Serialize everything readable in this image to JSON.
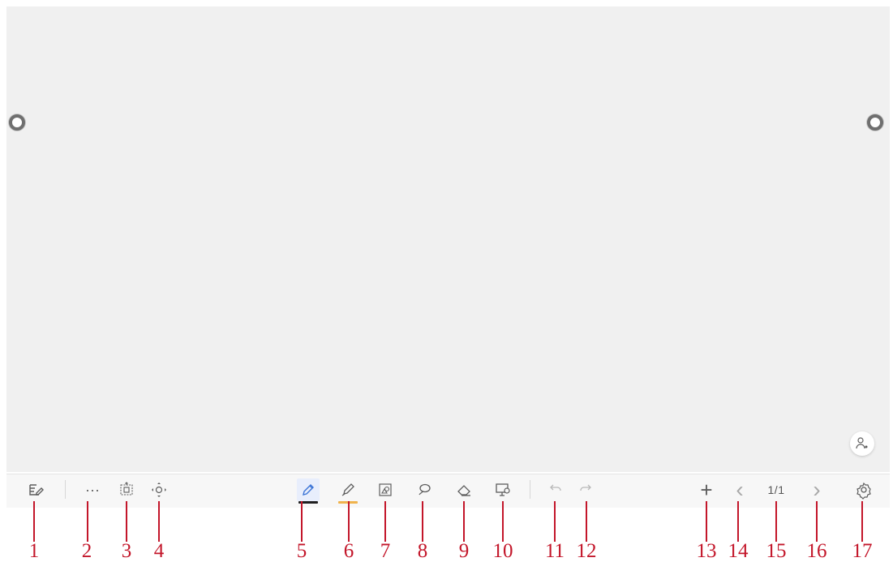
{
  "colors": {
    "canvas_background": "#f0f0f0",
    "toolbar_background": "#f7f7f7",
    "icon": "#5d5d5d",
    "callout_red": "#c3162a",
    "pen_underline": "#1f1f1f",
    "highlighter_underline": "#f0b34c",
    "active_tool_background": "#e8eefc"
  },
  "toolbar": {
    "items": [
      {
        "name": "exit-edit-button",
        "icon": "edit-note-icon"
      },
      {
        "name": "more-button",
        "icon": "ellipsis-icon",
        "label": "···"
      },
      {
        "name": "select-button",
        "icon": "selection-icon"
      },
      {
        "name": "roam-button",
        "icon": "move-icon"
      },
      {
        "name": "pen-button",
        "icon": "pen-icon",
        "active": true
      },
      {
        "name": "highlighter-button",
        "icon": "highlighter-icon"
      },
      {
        "name": "shape-button",
        "icon": "shape-icon"
      },
      {
        "name": "lasso-button",
        "icon": "lasso-icon"
      },
      {
        "name": "eraser-button",
        "icon": "eraser-icon"
      },
      {
        "name": "annotation-button",
        "icon": "presentation-icon"
      },
      {
        "name": "undo-button",
        "icon": "undo-icon"
      },
      {
        "name": "redo-button",
        "icon": "redo-icon"
      },
      {
        "name": "add-page-button",
        "icon": "plus-icon",
        "label": "+"
      },
      {
        "name": "previous-page-button",
        "icon": "chevron-left-icon",
        "label": "‹"
      },
      {
        "name": "page-indicator",
        "label": "1/1"
      },
      {
        "name": "next-page-button",
        "icon": "chevron-right-icon",
        "label": "›"
      },
      {
        "name": "settings-button",
        "icon": "gear-icon"
      }
    ]
  },
  "page_indicator": "1/1",
  "callouts": [
    "1",
    "2",
    "3",
    "4",
    "5",
    "6",
    "7",
    "8",
    "9",
    "10",
    "11",
    "12",
    "13",
    "14",
    "15",
    "16",
    "17"
  ],
  "floating_buttons": {
    "user_icon": "user-switch-icon"
  }
}
